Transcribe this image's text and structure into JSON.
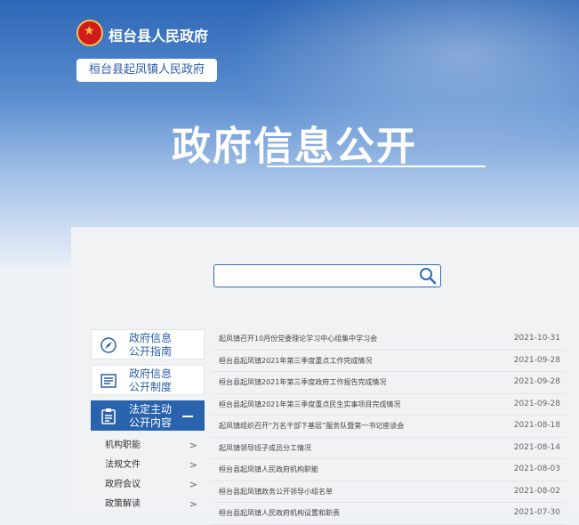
{
  "header": {
    "site_title": "桓台县人民政府",
    "sub_site": "桓台县起凤镇人民政府",
    "banner_title": "政府信息公开"
  },
  "search": {
    "placeholder": ""
  },
  "nav": {
    "items": [
      {
        "label_line1": "政府信息",
        "label_line2": "公开指南",
        "icon": "compass-icon"
      },
      {
        "label_line1": "政府信息",
        "label_line2": "公开制度",
        "icon": "document-icon"
      },
      {
        "label_line1": "法定主动",
        "label_line2": "公开内容",
        "icon": "clipboard-icon",
        "active": true
      }
    ],
    "subitems": [
      "机构职能",
      "法规文件",
      "政府会议",
      "政策解读"
    ]
  },
  "news": [
    {
      "title": "起凤镇召开10月份党委理论学习中心组集中学习会",
      "date": "2021-10-31"
    },
    {
      "title": "桓台县起凤镇2021年第三季度重点工作完成情况",
      "date": "2021-09-28"
    },
    {
      "title": "桓台县起凤镇2021年第三季度政府工作报告完成情况",
      "date": "2021-09-28"
    },
    {
      "title": "桓台县起凤镇2021年第三季度重点民生实事项目完成情况",
      "date": "2021-09-28"
    },
    {
      "title": "起凤镇组织召开“万名干部下基层”服务队暨第一书记座谈会",
      "date": "2021-08-18"
    },
    {
      "title": "起凤镇领导班子成员分工情况",
      "date": "2021-08-14"
    },
    {
      "title": "桓台县起凤镇人民政府机构职能",
      "date": "2021-08-03"
    },
    {
      "title": "桓台县起凤镇政务公开领导小组名单",
      "date": "2021-08-02"
    },
    {
      "title": "桓台县起凤镇人民政府机构设置和职责",
      "date": "2021-07-30"
    }
  ],
  "colors": {
    "brand_blue": "#2a63ad",
    "emblem_red": "#d11b1b"
  }
}
